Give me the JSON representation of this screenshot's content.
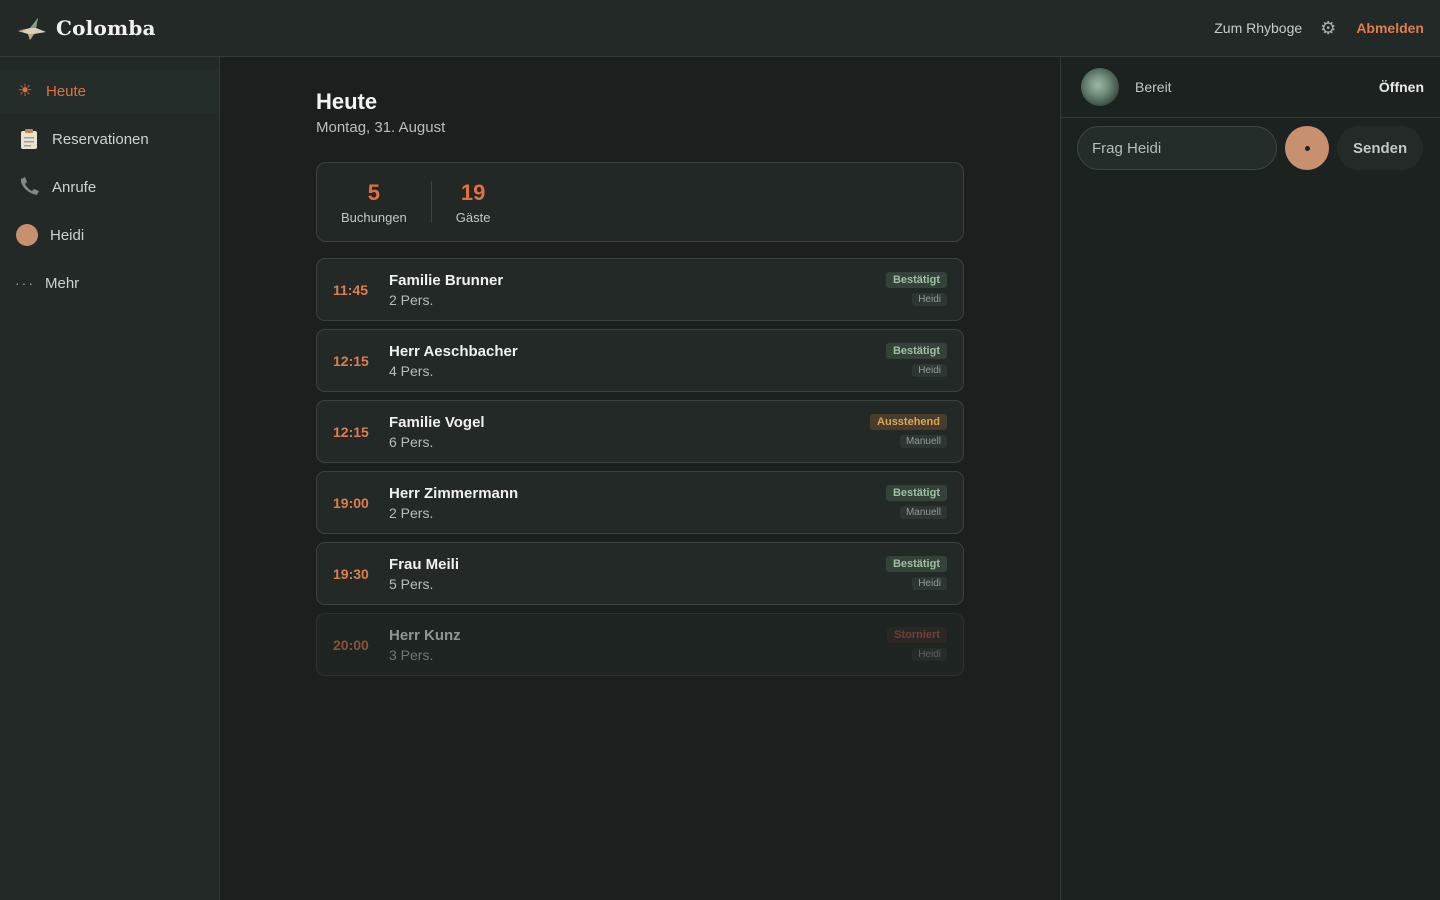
{
  "app": {
    "name": "Colomba"
  },
  "topbar": {
    "link_label": "Zum Rhyboge",
    "settings_icon": "gear-icon",
    "logout_label": "Abmelden"
  },
  "sidebar": {
    "items": [
      {
        "label": "Heute",
        "icon": "sun-icon",
        "active": true
      },
      {
        "label": "Reservationen",
        "icon": "clipboard-icon"
      },
      {
        "label": "Anrufe",
        "icon": "phone-icon"
      },
      {
        "label": "Heidi",
        "icon": "heidi-avatar-icon"
      },
      {
        "label": "Mehr",
        "icon": "more-dots-icon"
      }
    ]
  },
  "main": {
    "title": "Heute",
    "date": "Montag, 31. August",
    "stats": [
      {
        "value": "5",
        "label": "Buchungen"
      },
      {
        "value": "19",
        "label": "Gäste"
      }
    ],
    "reservations": [
      {
        "time": "11:45",
        "name": "Familie Brunner",
        "pers": "2 Pers.",
        "status": "Bestätigt",
        "source": "Heidi"
      },
      {
        "time": "12:15",
        "name": "Herr Aeschbacher",
        "pers": "4 Pers.",
        "status": "Bestätigt",
        "source": "Heidi"
      },
      {
        "time": "12:15",
        "name": "Familie Vogel",
        "pers": "6 Pers.",
        "status": "Ausstehend",
        "source": "Manuell"
      },
      {
        "time": "19:00",
        "name": "Herr Zimmermann",
        "pers": "2 Pers.",
        "status": "Bestätigt",
        "source": "Manuell"
      },
      {
        "time": "19:30",
        "name": "Frau Meili",
        "pers": "5 Pers.",
        "status": "Bestätigt",
        "source": "Heidi"
      },
      {
        "time": "20:00",
        "name": "Herr Kunz",
        "pers": "3 Pers.",
        "status": "Storniert",
        "source": "Heidi"
      }
    ]
  },
  "panel": {
    "status": "Bereit",
    "open_label": "Öffnen",
    "chat_placeholder": "Frag Heidi",
    "send_label": "Senden"
  },
  "colors": {
    "accent": "#e2703f",
    "heidi": "#c8906e",
    "confirmed": "#9fc09f",
    "pending": "#d9a658",
    "cancelled": "#b45d4c"
  }
}
